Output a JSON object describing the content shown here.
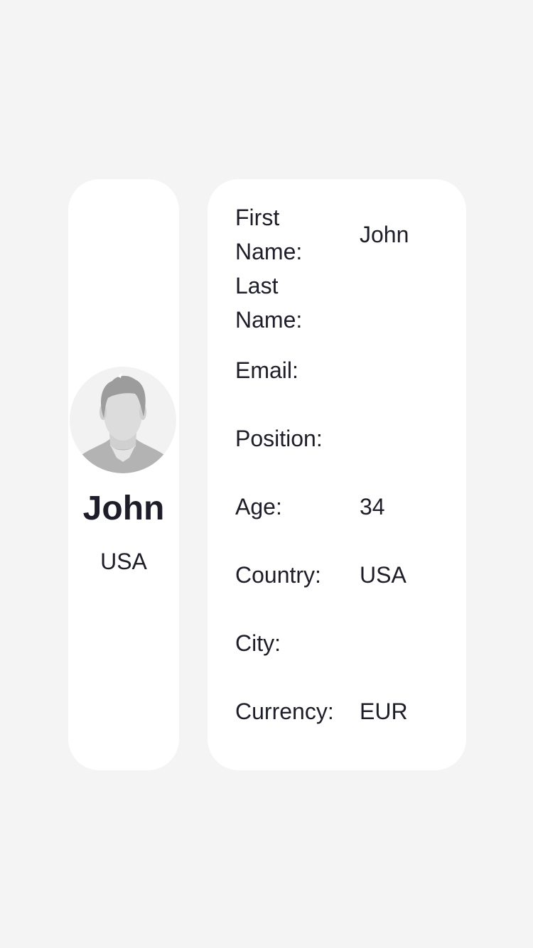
{
  "profile": {
    "name": "John",
    "country": "USA",
    "avatar_icon": "default-user-avatar"
  },
  "details": {
    "first_name_label": "First Name:",
    "first_name_value": "John",
    "last_name_label": "Last Name:",
    "last_name_value": "",
    "email_label": "Email:",
    "email_value": "",
    "position_label": "Position:",
    "position_value": "",
    "age_label": "Age:",
    "age_value": "34",
    "country_label": "Country:",
    "country_value": "USA",
    "city_label": "City:",
    "city_value": "",
    "currency_label": "Currency:",
    "currency_value": "EUR"
  },
  "colors": {
    "background": "#f4f4f4",
    "card": "#ffffff",
    "text": "#1e1e2a",
    "avatar_bg": "#f2f2f2",
    "avatar_silhouette": "#b3b3b3"
  }
}
